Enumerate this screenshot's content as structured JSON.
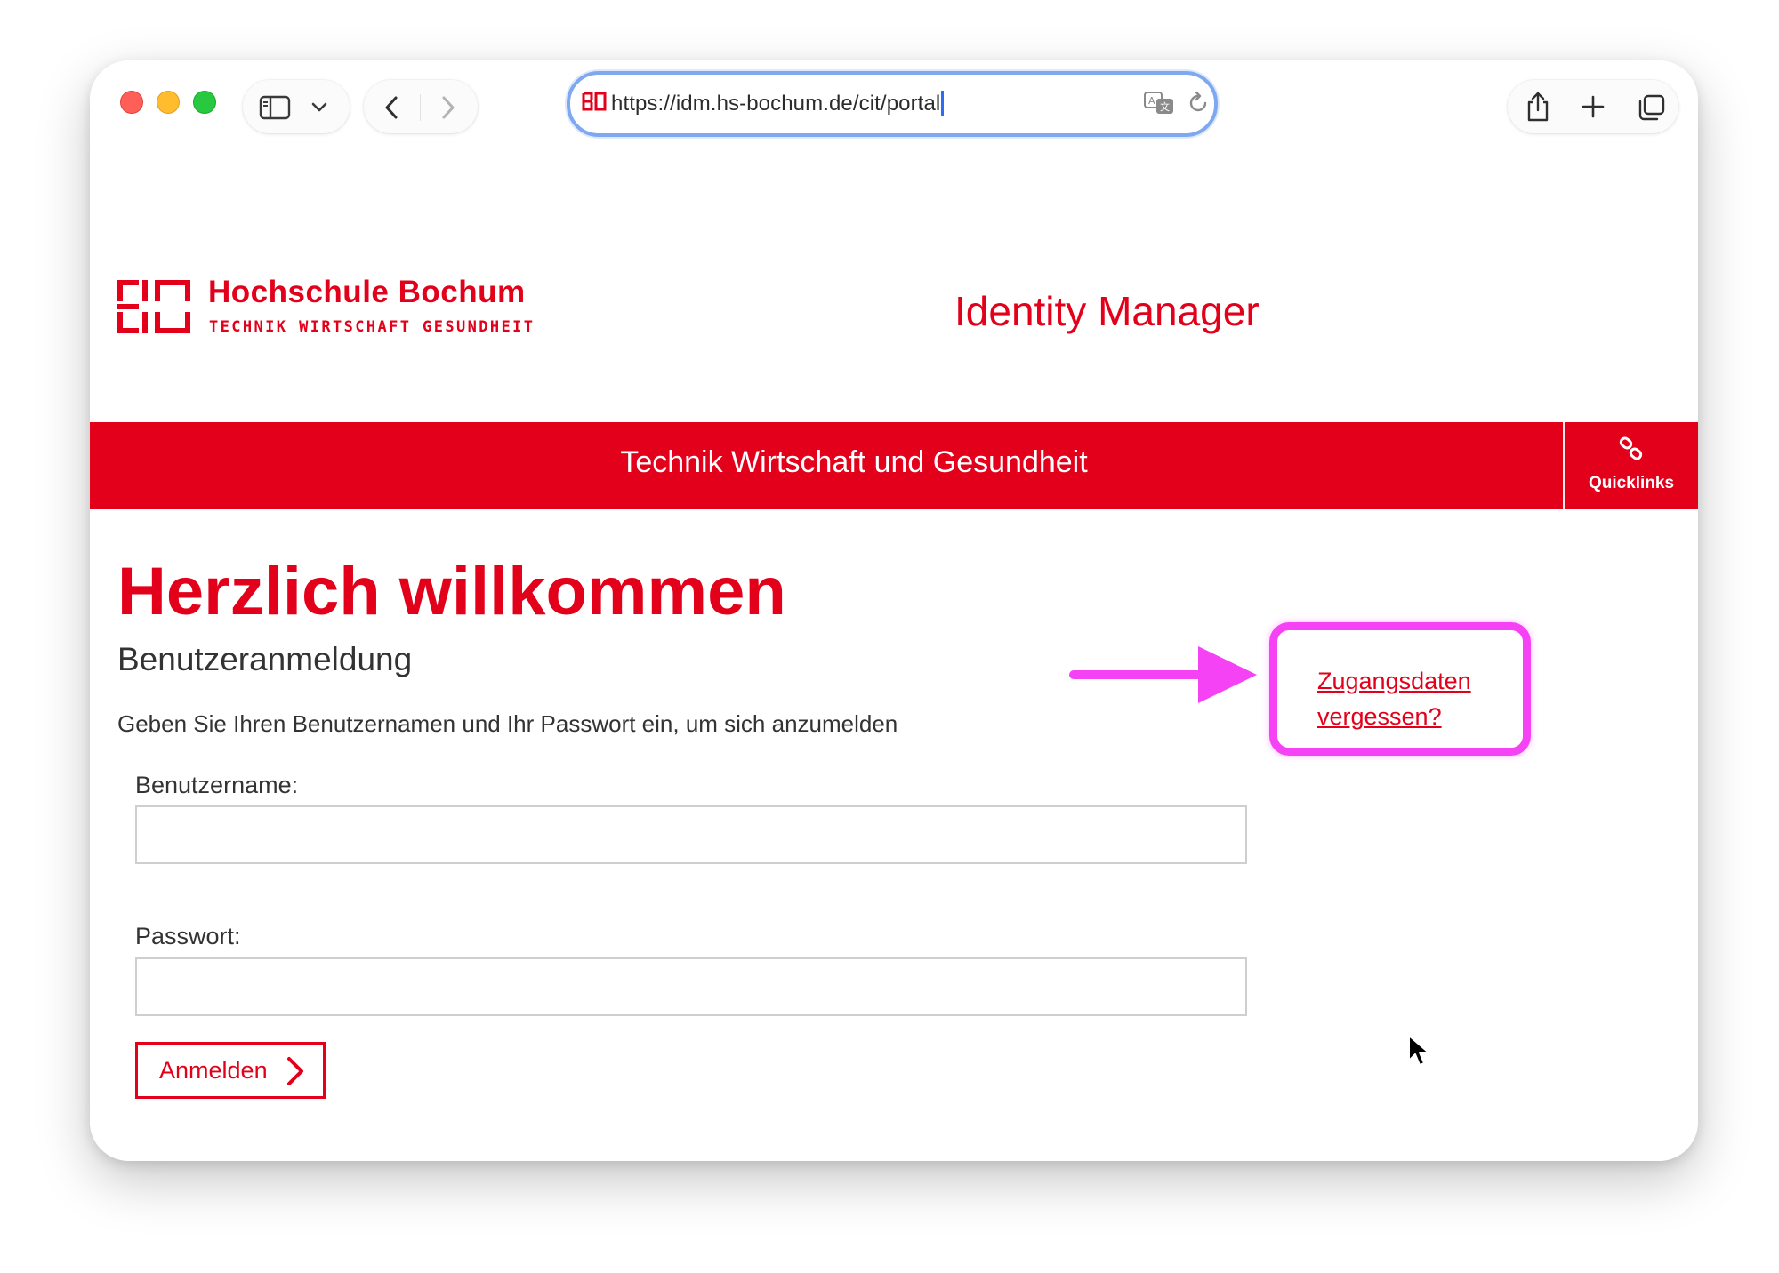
{
  "browser": {
    "url": "https://idm.hs-bochum.de/cit/portal",
    "favicon": "bo-logo-icon",
    "controls": [
      "sidebar-icon",
      "chevron-down-icon",
      "back-icon",
      "forward-icon",
      "translate-icon",
      "reload-icon",
      "share-icon",
      "new-tab-icon",
      "tabs-overview-icon"
    ]
  },
  "header": {
    "logo_name": "Hochschule Bochum",
    "logo_tagline": "TECHNIK WIRTSCHAFT GESUNDHEIT",
    "app_title": "Identity Manager"
  },
  "band": {
    "text": "Technik Wirtschaft und Gesundheit",
    "quicklinks_label": "Quicklinks",
    "quicklinks_icon": "link-icon"
  },
  "main": {
    "welcome": "Herzlich willkommen",
    "subheading": "Benutzeranmeldung",
    "instructions": "Geben Sie Ihren Benutzernamen und Ihr Passwort ein, um sich anzumelden",
    "username_label": "Benutzername:",
    "username_value": "",
    "password_label": "Passwort:",
    "password_value": "",
    "login_button": "Anmelden",
    "forgot_link": "Zugangsdaten vergessen?"
  },
  "colors": {
    "brand_red": "#e2001a",
    "annotation_magenta": "#f542f5",
    "url_focus_ring": "#7ea8f0"
  }
}
